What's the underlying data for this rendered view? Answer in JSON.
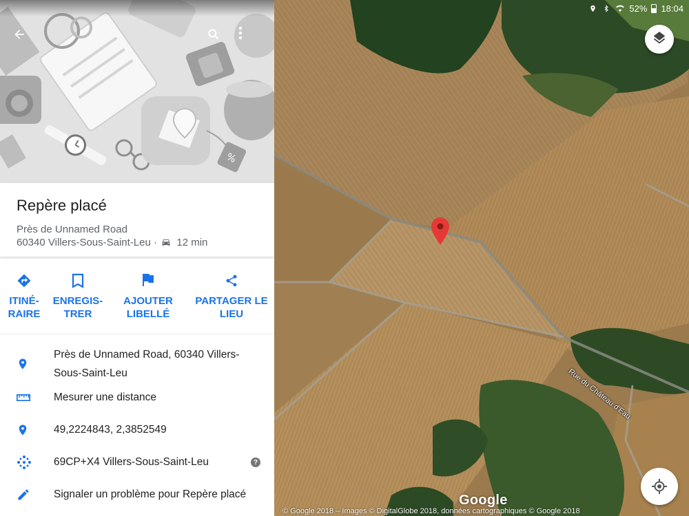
{
  "status_bar": {
    "battery": "52%",
    "time": "18:04"
  },
  "place": {
    "title": "Repère placé",
    "address_line1": "Près de Unnamed Road",
    "address_line2": "60340 Villers-Sous-Saint-Leu",
    "separator": "·",
    "drive_time": "12 min"
  },
  "actions": [
    {
      "label": "ITINÉ-\nRAIRE",
      "icon": "directions-icon"
    },
    {
      "label": "ENREGIS-\nTRER",
      "icon": "bookmark-icon"
    },
    {
      "label": "AJOUTER\nLIBELLÉ",
      "icon": "flag-icon"
    },
    {
      "label": "PARTAGER LE\nLIEU",
      "icon": "share-icon"
    }
  ],
  "details": [
    {
      "icon": "location-pin-icon",
      "text": "Près de Unnamed Road, 60340 Villers-Sous-Saint-Leu"
    },
    {
      "icon": "ruler-icon",
      "text": "Mesurer une distance"
    },
    {
      "icon": "location-pin-icon",
      "text": "49,2224843, 2,3852549"
    },
    {
      "icon": "plus-code-icon",
      "text": "69CP+X4 Villers-Sous-Saint-Leu",
      "help": "?"
    },
    {
      "icon": "edit-pencil-icon",
      "text": "Signaler un problème pour Repère placé"
    }
  ],
  "map": {
    "road_label": "Rue du Château d'Eau",
    "logo": "Google",
    "copyright": "© Google 2018 – Images © DigitalGlobe 2018, données cartographiques © Google 2018"
  },
  "colors": {
    "accent": "#1a73e8",
    "pin": "#e53935"
  }
}
